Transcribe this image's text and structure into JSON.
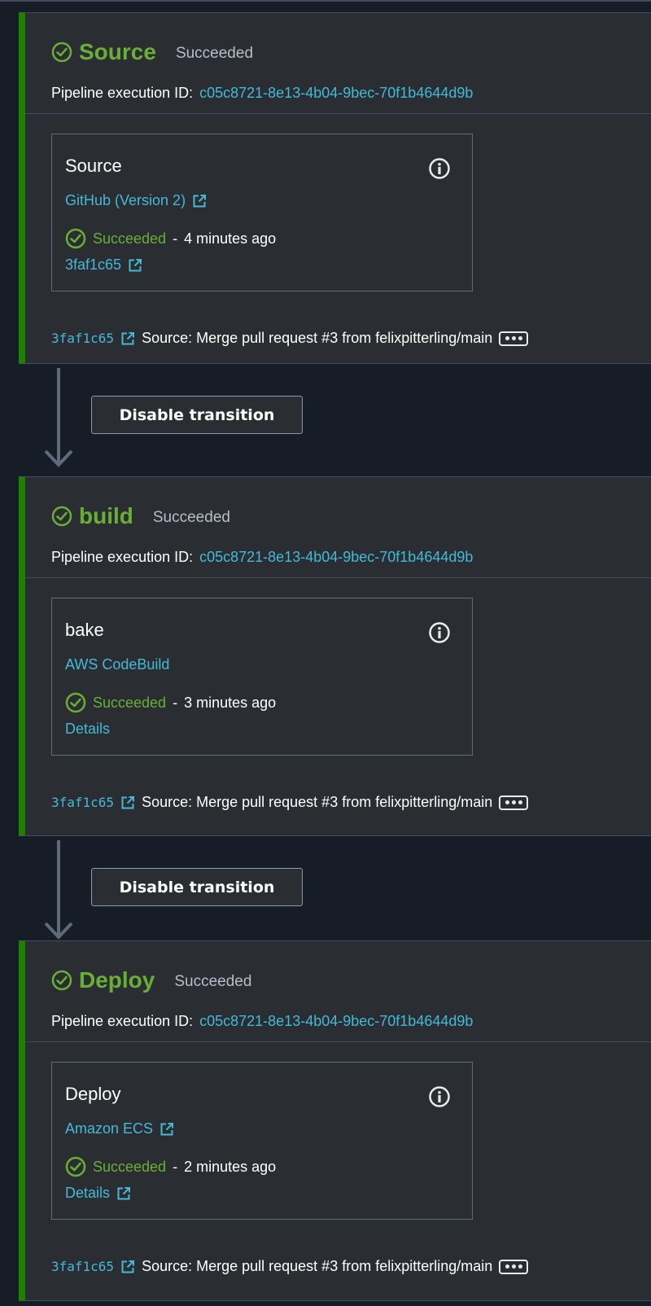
{
  "exec_label": "Pipeline execution ID:",
  "transition_label": "Disable transition",
  "separator": "-",
  "stages": [
    {
      "title": "Source",
      "status": "Succeeded",
      "execution_id": "c05c8721-8e13-4b04-9bec-70f1b4644d9b",
      "action": {
        "name": "Source",
        "provider": "GitHub (Version 2)",
        "status": "Succeeded",
        "time": "4 minutes ago",
        "detail": "3faf1c65"
      },
      "commit_id": "3faf1c65",
      "commit_message": "Source: Merge pull request #3 from felixpitterling/main"
    },
    {
      "title": "build",
      "status": "Succeeded",
      "execution_id": "c05c8721-8e13-4b04-9bec-70f1b4644d9b",
      "action": {
        "name": "bake",
        "provider": "AWS CodeBuild",
        "status": "Succeeded",
        "time": "3 minutes ago",
        "detail": "Details"
      },
      "commit_id": "3faf1c65",
      "commit_message": "Source: Merge pull request #3 from felixpitterling/main"
    },
    {
      "title": "Deploy",
      "status": "Succeeded",
      "execution_id": "c05c8721-8e13-4b04-9bec-70f1b4644d9b",
      "action": {
        "name": "Deploy",
        "provider": "Amazon ECS",
        "status": "Succeeded",
        "time": "2 minutes ago",
        "detail": "Details"
      },
      "commit_id": "3faf1c65",
      "commit_message": "Source: Merge pull request #3 from felixpitterling/main"
    }
  ],
  "colors": {
    "success": "#6aaf35",
    "link": "#44b9d6",
    "stage_border": "#1d8102",
    "panel": "#2a2e33",
    "background": "#161d26"
  }
}
